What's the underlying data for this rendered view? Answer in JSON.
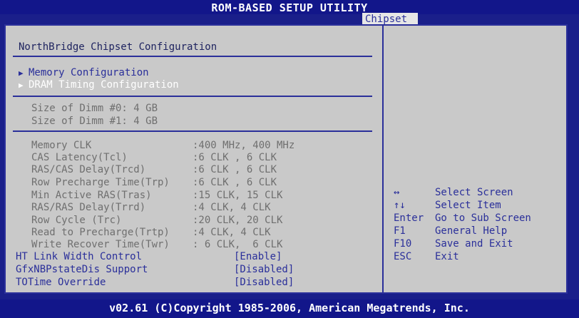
{
  "header": {
    "title": "ROM-BASED SETUP UTILITY",
    "tab": "Chipset"
  },
  "panel": {
    "title": "NorthBridge Chipset Configuration",
    "menu": [
      {
        "label": "Memory Configuration"
      },
      {
        "label": "DRAM Timing Configuration"
      }
    ],
    "dimm": [
      {
        "text": "Size of Dimm #0: 4 GB"
      },
      {
        "text": "Size of Dimm #1: 4 GB"
      }
    ],
    "timings": [
      {
        "label": "Memory CLK",
        "value": ":400 MHz, 400 MHz"
      },
      {
        "label": "CAS Latency(Tcl)",
        "value": ":6 CLK , 6 CLK"
      },
      {
        "label": "RAS/CAS Delay(Trcd)",
        "value": ":6 CLK , 6 CLK"
      },
      {
        "label": "Row Precharge Time(Trp)",
        "value": ":6 CLK , 6 CLK"
      },
      {
        "label": "Min Active RAS(Tras)",
        "value": ":15 CLK, 15 CLK"
      },
      {
        "label": "RAS/RAS Delay(Trrd)",
        "value": ":4 CLK, 4 CLK"
      },
      {
        "label": "Row Cycle (Trc)",
        "value": ":20 CLK, 20 CLK"
      },
      {
        "label": "Read to Precharge(Trtp)",
        "value": ":4 CLK, 4 CLK"
      },
      {
        "label": "Write Recover Time(Twr)",
        "value": ": 6 CLK,  6 CLK"
      }
    ],
    "options": [
      {
        "label": "HT Link Width Control",
        "value": "[Enable]"
      },
      {
        "label": "GfxNBPstateDis Support",
        "value": "[Disabled]"
      },
      {
        "label": "TOTime Override",
        "value": "[Disabled]"
      }
    ]
  },
  "help": [
    {
      "key": "↔",
      "action": "Select Screen"
    },
    {
      "key": "↑↓",
      "action": "Select Item"
    },
    {
      "key": "Enter",
      "action": "Go to Sub Screen"
    },
    {
      "key": "F1",
      "action": "General Help"
    },
    {
      "key": "F10",
      "action": "Save and Exit"
    },
    {
      "key": "ESC",
      "action": "Exit"
    }
  ],
  "footer": {
    "text": "v02.61 (C)Copyright 1985-2006, American Megatrends, Inc."
  },
  "colors": {
    "background": "#1a1f8a",
    "panel": "#c9c9c9",
    "accent": "#2a2f9a",
    "dim_text": "#6f6f6f"
  }
}
